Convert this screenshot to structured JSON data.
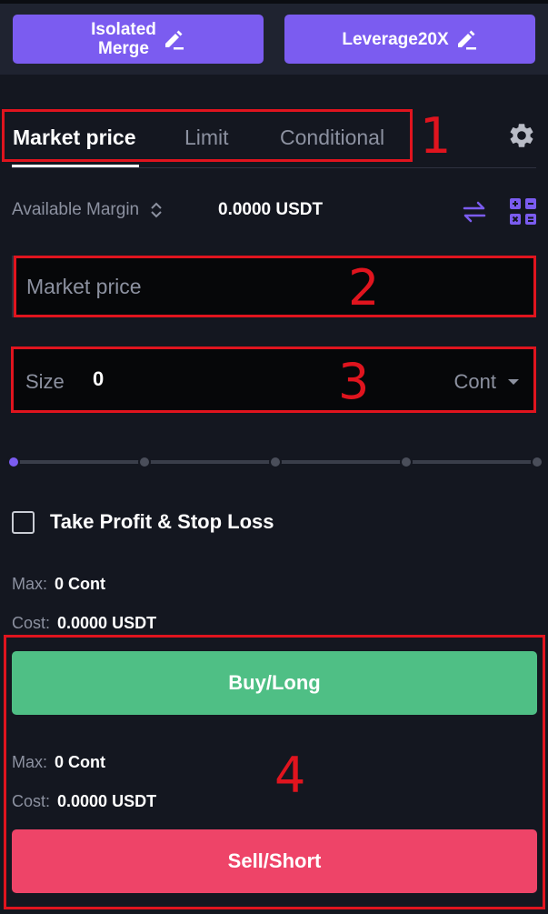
{
  "topbar": {
    "margin_line1": "Isolated",
    "margin_line2": "Merge",
    "leverage_label": "Leverage20X"
  },
  "tabs": [
    {
      "label": "Market price",
      "active": true
    },
    {
      "label": "Limit",
      "active": false
    },
    {
      "label": "Conditional",
      "active": false
    }
  ],
  "annotations": [
    "1",
    "2",
    "3",
    "4"
  ],
  "available": {
    "label": "Available Margin",
    "value": "0.0000 USDT"
  },
  "price_field": {
    "placeholder": "Market price"
  },
  "size_field": {
    "label": "Size",
    "value": "0",
    "unit": "Cont"
  },
  "slider": {
    "fraction": 0
  },
  "tpsl": {
    "label": "Take Profit & Stop Loss",
    "checked": false
  },
  "buy": {
    "max_label": "Max:",
    "max_value": "0 Cont",
    "cost_label": "Cost:",
    "cost_value": "0.0000 USDT",
    "button_label": "Buy/Long"
  },
  "sell": {
    "max_label": "Max:",
    "max_value": "0 Cont",
    "cost_label": "Cost:",
    "cost_value": "0.0000 USDT",
    "button_label": "Sell/Short"
  },
  "colors": {
    "accent": "#7b5cf0",
    "buy": "#4fbf85",
    "sell": "#ee4468",
    "annotation": "#e0141e"
  },
  "icons": [
    "edit-icon",
    "gear-icon",
    "sort-icon",
    "swap-icon",
    "calculator-icon",
    "chevron-down-icon",
    "checkbox"
  ]
}
